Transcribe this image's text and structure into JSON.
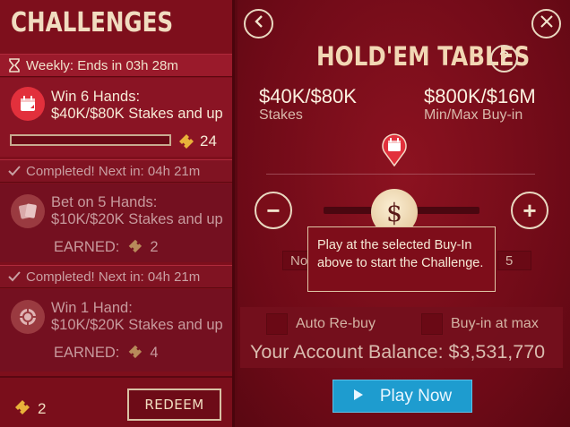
{
  "left_panel": {
    "title": "CHALLENGES",
    "weekly_header": "Weekly:  Ends in 03h 28m",
    "challenges": [
      {
        "line1": "Win 6 Hands:",
        "line2": "$40K/$80K Stakes and up",
        "progress": 0,
        "reward": "24",
        "icon": "calendar-icon"
      },
      {
        "status": "Completed!  Next in: 04h 21m",
        "line1": "Bet on 5 Hands:",
        "line2": "$10K/$20K Stakes and up",
        "earned_label": "EARNED:",
        "earned": "2",
        "icon": "cards-icon"
      },
      {
        "status": "Completed!  Next in: 04h 21m",
        "line1": "Win 1 Hand:",
        "line2": "$10K/$20K Stakes and up",
        "earned_label": "EARNED:",
        "earned": "4",
        "icon": "chip-icon"
      }
    ],
    "tickets": "2",
    "redeem_label": "REDEEM"
  },
  "right_panel": {
    "title": "HOLD'EM TABLES",
    "help_label": "?",
    "stakes_value": "$40K/$80K",
    "stakes_label": "Stakes",
    "buyin_value": "$800K/$16M",
    "buyin_label": "Min/Max Buy-in",
    "minus_label": "−",
    "plus_label": "+",
    "knob_label": "$",
    "min_box_text": "No",
    "max_box_text": "5",
    "tooltip_text": "Play at the selected Buy-In above to start the Challenge.",
    "auto_rebuy_label": "Auto Re-buy",
    "buyin_max_label": "Buy-in at max",
    "balance_text": "Your Account Balance: $3,531,770",
    "play_label": "Play Now"
  },
  "colors": {
    "panel": "#7e0f1c",
    "accent_red": "#e2303c",
    "play_blue": "#1e9ccf",
    "ticket_gold": "#e8b23a"
  }
}
